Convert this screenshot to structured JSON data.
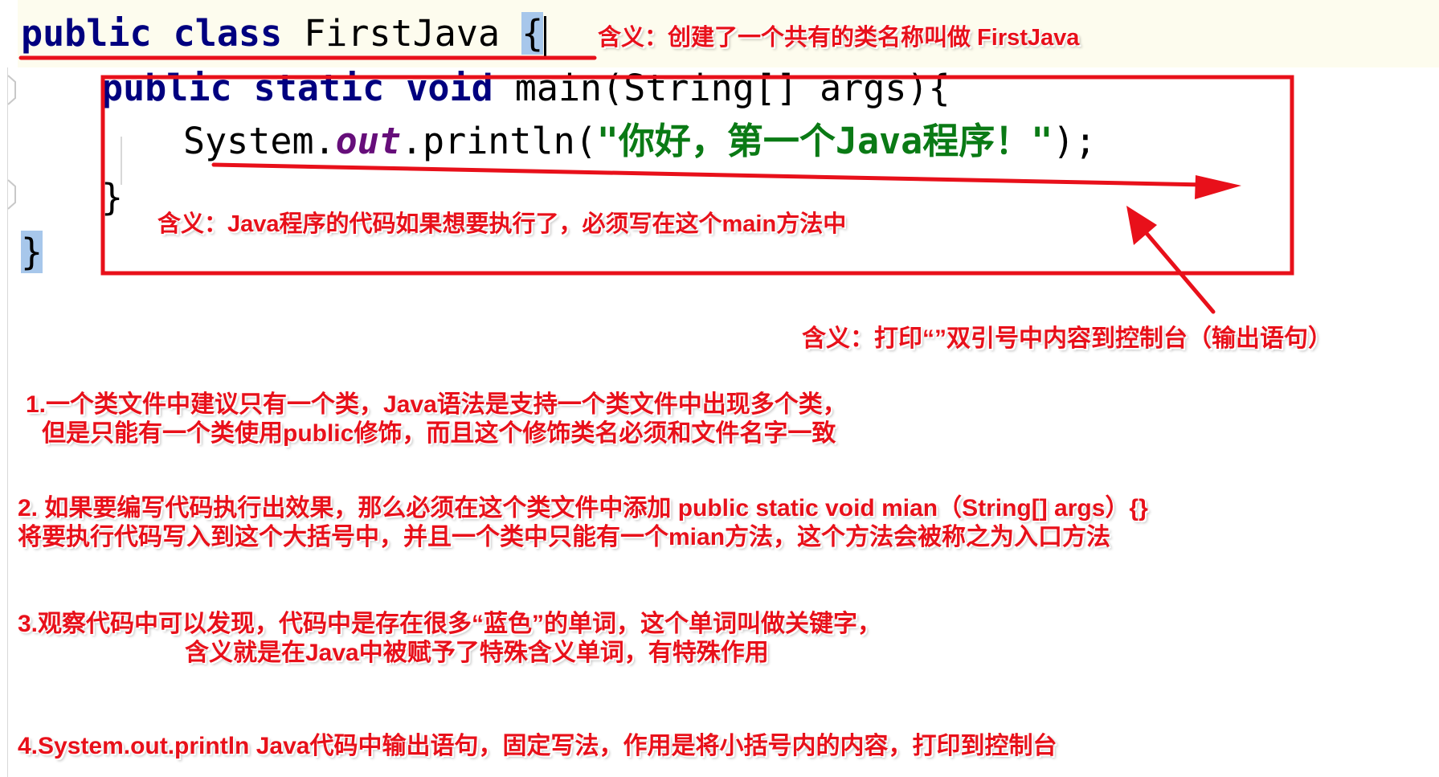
{
  "code": {
    "line1": {
      "kw1": "public",
      "kw2": "class",
      "name": "FirstJava",
      "brace": "{"
    },
    "line2": {
      "kw1": "public",
      "kw2": "static",
      "kw3": "void",
      "rest": "main(String[] args){"
    },
    "line3": {
      "obj": "System.",
      "field": "out",
      "call": ".println(",
      "str": "\"你好，第一个Java程序！\"",
      "end": ");"
    },
    "line4": {
      "brace": "}"
    },
    "line5": {
      "brace": "}"
    }
  },
  "annotations": {
    "class_meaning": "含义：创建了一个共有的类名称叫做 FirstJava",
    "main_meaning": "含义：Java程序的代码如果想要执行了，必须写在这个main方法中",
    "print_meaning": "含义：打印“”双引号中内容到控制台（输出语句）",
    "note1_line1": "1.一个类文件中建议只有一个类，Java语法是支持一个类文件中出现多个类，",
    "note1_line2": "但是只能有一个类使用public修饰，而且这个修饰类名必须和文件名字一致",
    "note2_line1": "2. 如果要编写代码执行出效果，那么必须在这个类文件中添加 public static void mian（String[] args）{}",
    "note2_line2": "将要执行代码写入到这个大括号中，并且一个类中只能有一个mian方法，这个方法会被称之为入口方法",
    "note3_line1": "3.观察代码中可以发现，代码中是存在很多“蓝色”的单词，这个单词叫做关键字，",
    "note3_line2": "含义就是在Java中被赋予了特殊含义单词，有特殊作用",
    "note4": "4.System.out.println Java代码中输出语句，固定写法，作用是将小括号内的内容，打印到控制台"
  },
  "colors": {
    "keyword": "#00007f",
    "string": "#0a7a15",
    "field": "#660e7a",
    "annotation": "#e8101a",
    "brace_highlight": "#a7c7eb",
    "line_highlight": "#fdfcee"
  }
}
